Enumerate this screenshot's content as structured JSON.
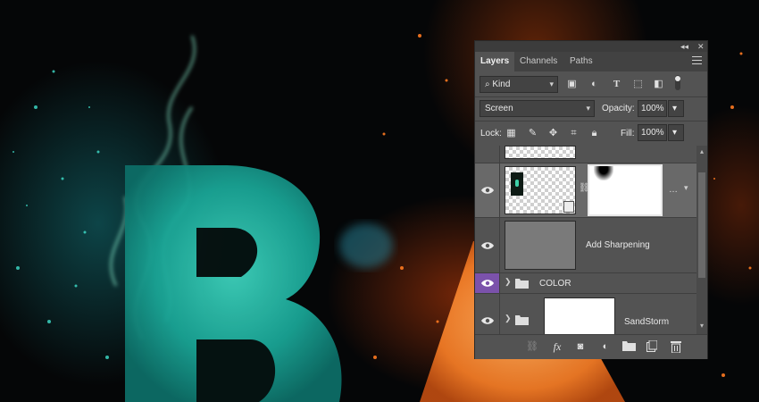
{
  "panel": {
    "tabs": [
      {
        "label": "Layers"
      },
      {
        "label": "Channels"
      },
      {
        "label": "Paths"
      }
    ],
    "filter": {
      "label": "Kind"
    },
    "blend": {
      "mode": "Screen",
      "opacity_label": "Opacity:",
      "opacity_value": "100%"
    },
    "lock": {
      "label": "Lock:",
      "fill_label": "Fill:",
      "fill_value": "100%"
    },
    "layers": [
      {
        "name": "",
        "selected": false
      },
      {
        "name": "",
        "selected": true
      },
      {
        "name": "Add Sharpening",
        "selected": false
      },
      {
        "name": "COLOR",
        "type": "group",
        "eye_color": "#7b52ab"
      },
      {
        "name": "SandStorm",
        "type": "group"
      }
    ],
    "colors": {
      "panel_bg": "#535353",
      "selected_row": "#696969",
      "eye_highlight": "#7b52ab"
    }
  }
}
